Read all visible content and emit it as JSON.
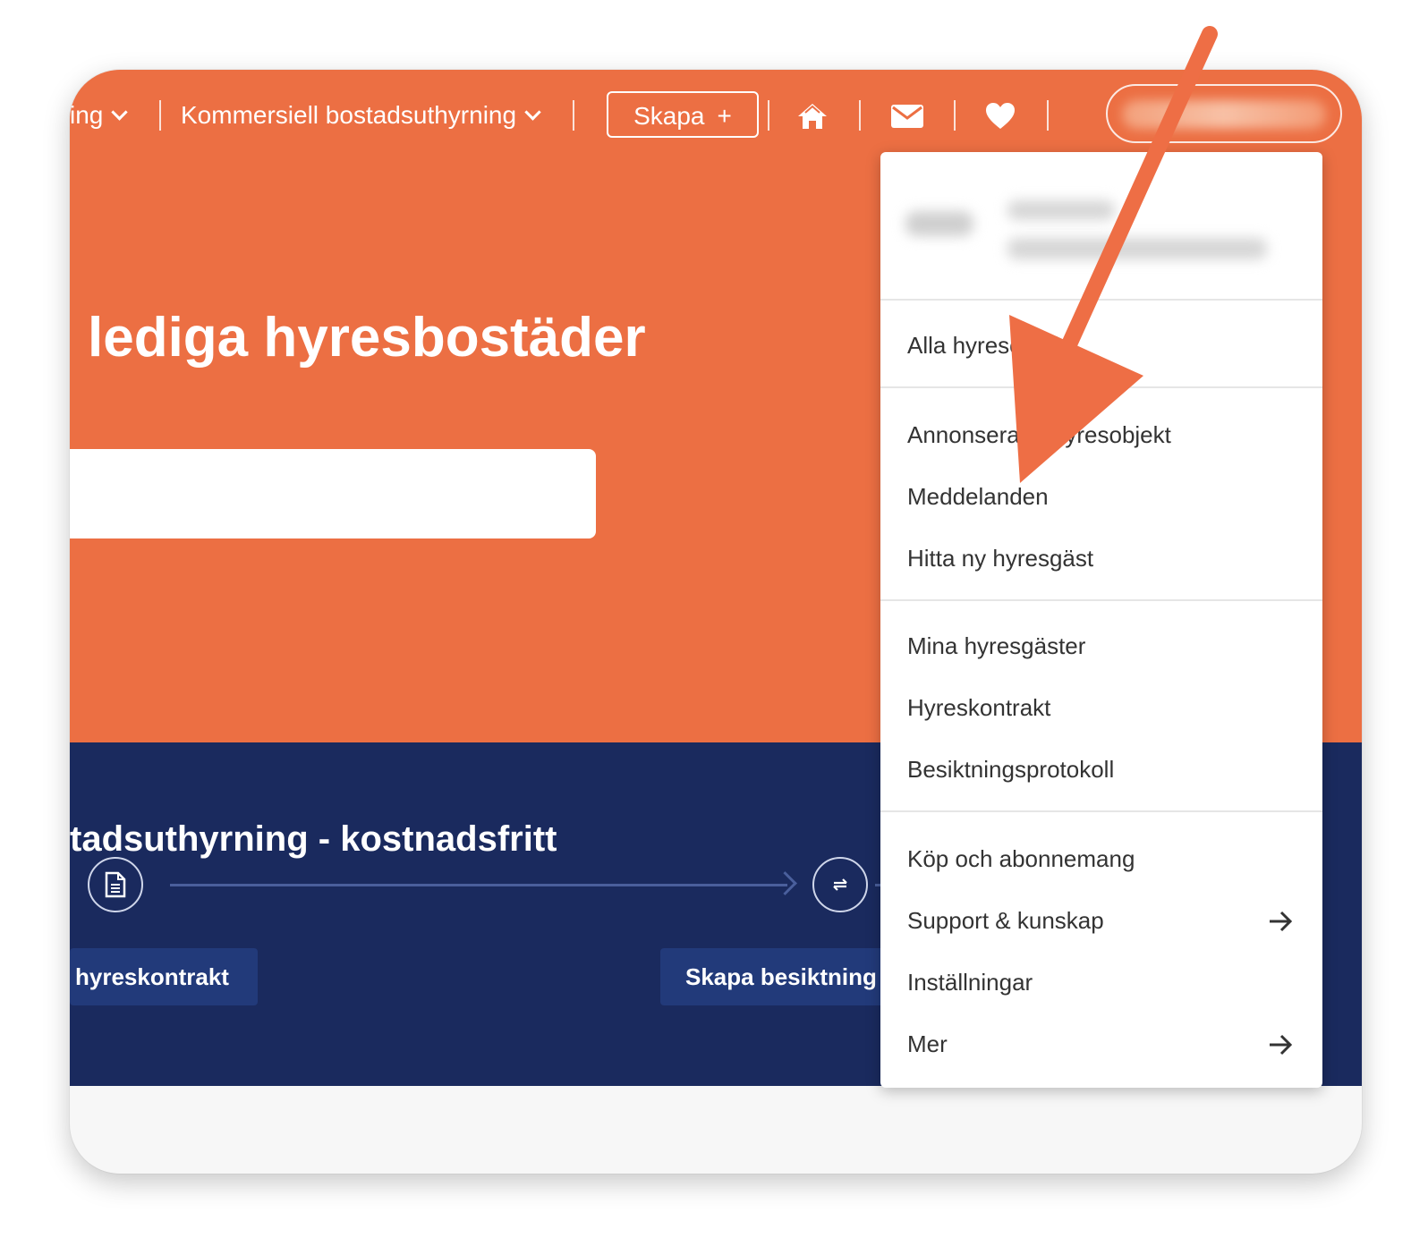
{
  "colors": {
    "brand": "#EC6F43",
    "navy": "#1A2A5E",
    "annotation_arrow": "#EE6E45"
  },
  "nav": {
    "partial_item": "ing",
    "commercial": "Kommersiell bostadsuthyrning",
    "create_label": "Skapa",
    "create_plus": "+",
    "icons": [
      "home-icon",
      "mail-icon",
      "heart-icon"
    ]
  },
  "hero": {
    "headline": "lediga hyresbostäder"
  },
  "promo": {
    "title": "tadsuthyrning - kostnadsfritt",
    "button_contract": "hyreskontrakt",
    "button_inspection": "Skapa besiktning"
  },
  "menu": {
    "items": [
      {
        "label": "Alla hyresobjekt"
      },
      {
        "label": "Annonserade hyresobjekt"
      },
      {
        "label": "Meddelanden"
      },
      {
        "label": "Hitta ny hyresgäst"
      },
      {
        "label": "Mina hyresgäster"
      },
      {
        "label": "Hyreskontrakt"
      },
      {
        "label": "Besiktningsprotokoll"
      },
      {
        "label": "Köp och abonnemang"
      },
      {
        "label": "Support & kunskap"
      },
      {
        "label": "Inställningar"
      },
      {
        "label": "Mer"
      }
    ]
  }
}
